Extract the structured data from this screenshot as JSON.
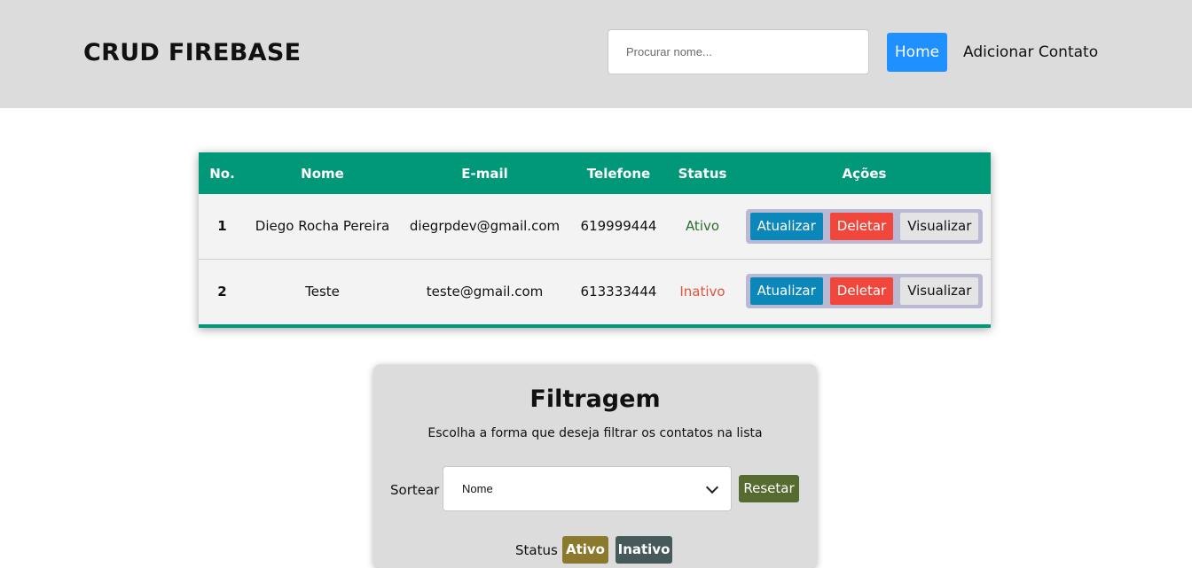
{
  "header": {
    "brand": "CRUD FIREBASE",
    "search_placeholder": "Procurar nome...",
    "nav": {
      "home": "Home",
      "add_contact": "Adicionar Contato"
    }
  },
  "table": {
    "columns": [
      "No.",
      "Nome",
      "E-mail",
      "Telefone",
      "Status",
      "Ações"
    ],
    "rows": [
      {
        "no": "1",
        "name": "Diego Rocha Pereira",
        "email": "diegrpdev@gmail.com",
        "phone": "619999444",
        "status": "Ativo",
        "actions": {
          "update": "Atualizar",
          "delete": "Deletar",
          "view": "Visualizar"
        }
      },
      {
        "no": "2",
        "name": "Teste",
        "email": "teste@gmail.com",
        "phone": "613333444",
        "status": "Inativo",
        "actions": {
          "update": "Atualizar",
          "delete": "Deletar",
          "view": "Visualizar"
        }
      }
    ]
  },
  "filter": {
    "title": "Filtragem",
    "subtitle": "Escolha a forma que deseja filtrar os contatos na lista",
    "sort_label": "Sortear",
    "sort_selected": "Nome",
    "reset": "Resetar",
    "status_label": "Status",
    "active": "Ativo",
    "inactive": "Inativo"
  },
  "colors": {
    "header_bg": "#dcdcdc",
    "table_header": "#009879",
    "home_button": "#1e90ff",
    "update_button": "#0b87ba",
    "delete_button": "#f0463c",
    "reset_button": "#556b2f"
  }
}
